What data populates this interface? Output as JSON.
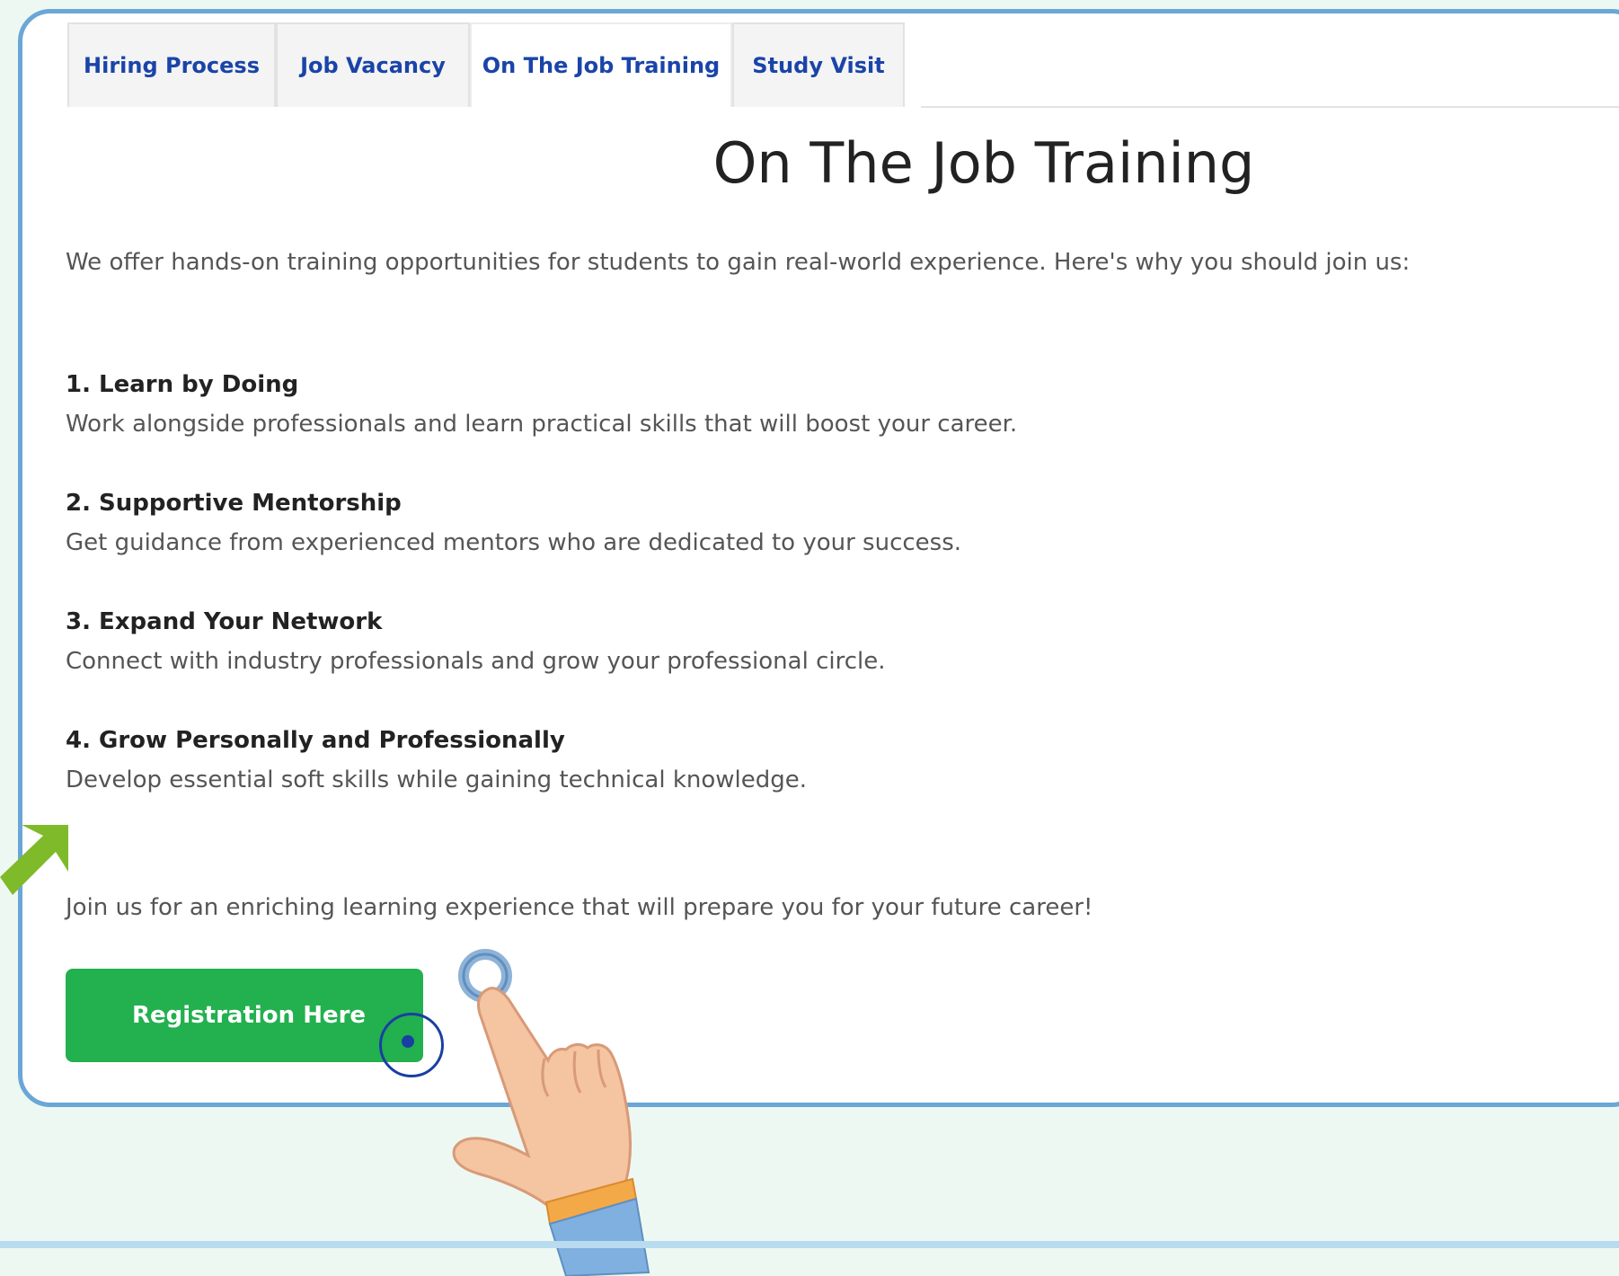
{
  "tabs": [
    {
      "label": "Hiring Process"
    },
    {
      "label": "Job Vacancy"
    },
    {
      "label": "On The Job Training"
    },
    {
      "label": "Study Visit"
    }
  ],
  "page": {
    "title": "On The Job Training",
    "intro": "We offer hands-on training opportunities for students to gain real-world experience. Here's why you should join us:",
    "benefits": [
      {
        "title": "1. Learn by Doing",
        "description": "Work alongside professionals and learn practical skills that will boost your career."
      },
      {
        "title": "2. Supportive Mentorship",
        "description": "Get guidance from experienced mentors who are dedicated to your success."
      },
      {
        "title": "3. Expand Your Network",
        "description": "Connect with industry professionals and grow your professional circle."
      },
      {
        "title": "4. Grow Personally and Professionally",
        "description": "Develop essential soft skills while gaining technical knowledge."
      }
    ],
    "outro": "Join us for an enriching learning experience that will prepare you for your future career!",
    "cta_label": "Registration Here"
  },
  "colors": {
    "tab_text": "#1a44a8",
    "cta_bg": "#23b04f",
    "frame_border": "#6aa7d6",
    "arrow": "#7fba2a",
    "background": "#eef8f3"
  },
  "decorations": {
    "arrow_icon": "green-arrow-icon",
    "hand_icon": "pointing-hand-icon",
    "click_indicator": "click-ring-icon"
  }
}
